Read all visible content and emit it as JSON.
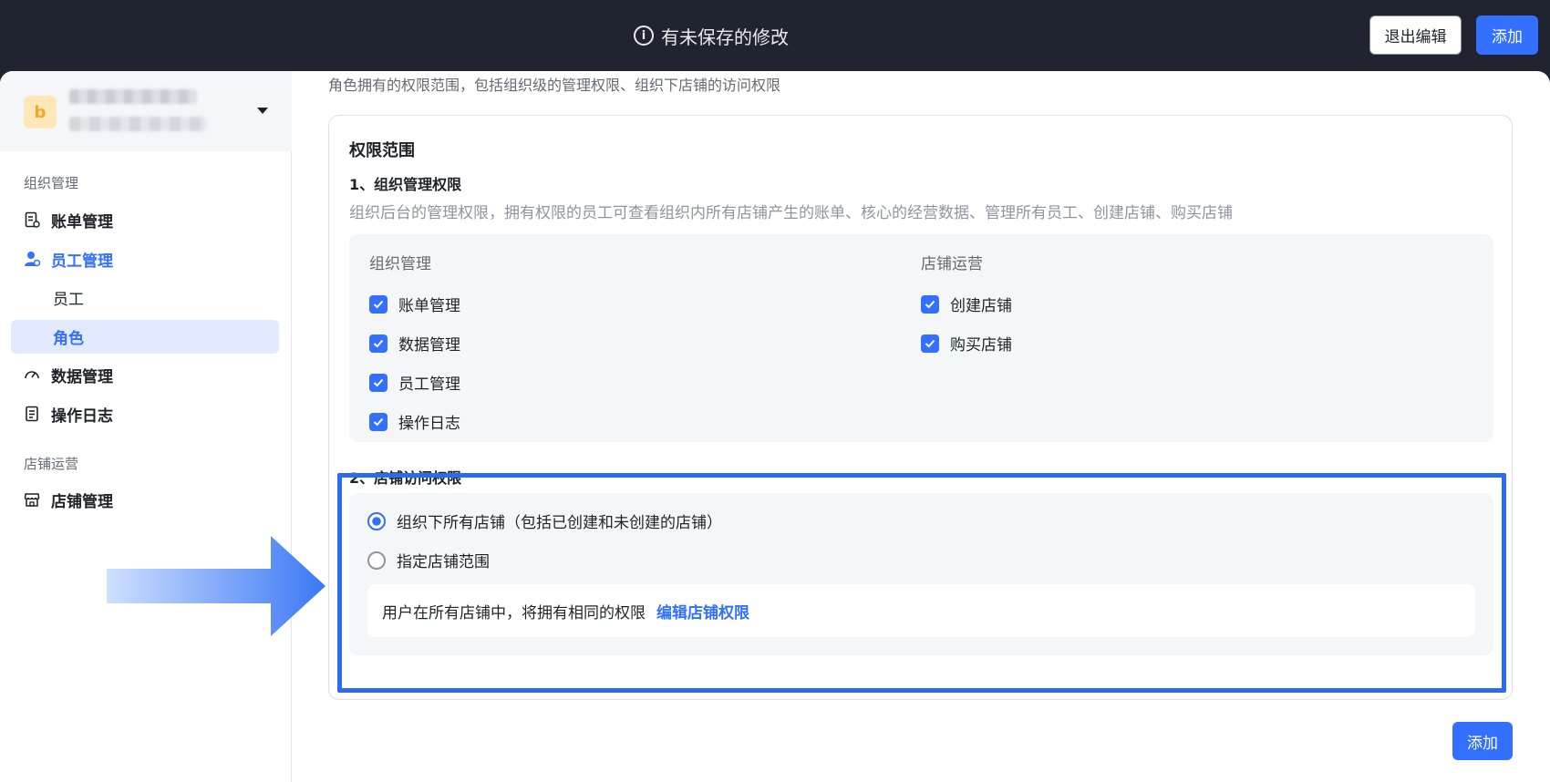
{
  "header": {
    "notice_text": "有未保存的修改",
    "exit_label": "退出编辑",
    "add_label": "添加"
  },
  "sidebar": {
    "org_avatar_letter": "b",
    "groups": [
      {
        "title": "组织管理"
      },
      {
        "title": "店铺运营"
      }
    ],
    "items": {
      "billing": "账单管理",
      "staff": "员工管理",
      "staff_sub_employee": "员工",
      "staff_sub_role": "角色",
      "data": "数据管理",
      "logs": "操作日志",
      "store": "店铺管理"
    }
  },
  "content": {
    "description": "角色拥有的权限范围，包括组织级的管理权限、组织下店铺的访问权限",
    "card_title": "权限范围",
    "section1": {
      "title": "1、组织管理权限",
      "description": "组织后台的管理权限，拥有权限的员工可查看组织内所有店铺产生的账单、核心的经营数据、管理所有员工、创建店铺、购买店铺",
      "col1_title": "组织管理",
      "col1_items": [
        "账单管理",
        "数据管理",
        "员工管理",
        "操作日志"
      ],
      "col2_title": "店铺运营",
      "col2_items": [
        "创建店铺",
        "购买店铺"
      ]
    },
    "section2": {
      "title": "2、店铺访问权限",
      "option_all": "组织下所有店铺（包括已创建和未创建的店铺）",
      "option_specific": "指定店铺范围",
      "selected": "option_all",
      "info_text": "用户在所有店铺中，将拥有相同的权限",
      "info_link": "编辑店铺权限"
    },
    "add_label": "添加"
  },
  "colors": {
    "accent": "#3370ff",
    "topbar": "#1f2430",
    "highlight": "#2c6bf0"
  }
}
